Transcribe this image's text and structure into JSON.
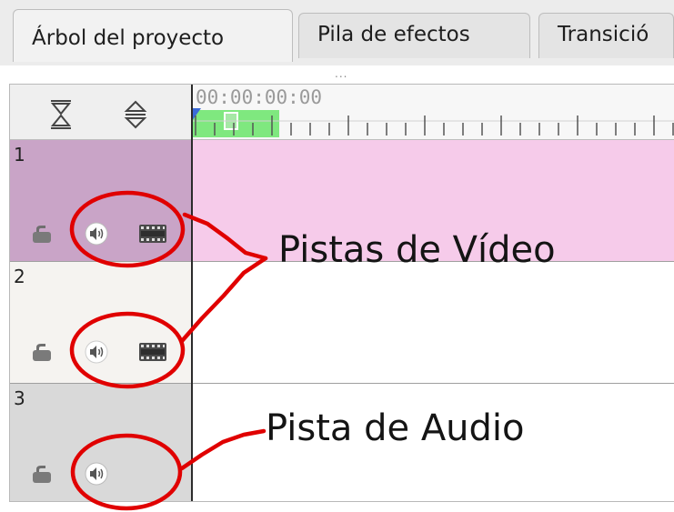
{
  "tabs": [
    {
      "label": "Árbol del proyecto"
    },
    {
      "label": "Pila de efectos"
    },
    {
      "label": "Transició"
    }
  ],
  "timeline": {
    "timecode": "00:00:00:00",
    "tracks": [
      {
        "number": "1",
        "kind": "video"
      },
      {
        "number": "2",
        "kind": "video"
      },
      {
        "number": "3",
        "kind": "audio"
      }
    ]
  },
  "annotations": {
    "video_label": "Pistas de Vídeo",
    "audio_label": "Pista de Audio"
  },
  "icons": {
    "collapse": "collapse-all-icon",
    "expand": "expand-all-icon",
    "lock": "lock-icon",
    "audio": "speaker-icon",
    "video": "film-strip-icon"
  },
  "colors": {
    "selected_track_header": "#c9a4c7",
    "selected_track_content": "#f6cbea",
    "annotation_red": "#e00000",
    "zone_green": "#7fe87f"
  }
}
